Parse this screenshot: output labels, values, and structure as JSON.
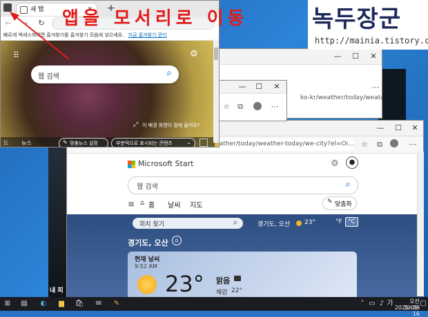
{
  "annotation": "앱을 모서리로 이동",
  "brand": {
    "name": "녹두장군",
    "url": "http://mainia.tistory.com"
  },
  "win_front": {
    "tab_title": "새 탭",
    "new_tab_symbol": "+",
    "favorites_bar_text": "빠르게 액세스하려면 즐겨찾기를 즐겨찾기 모음에 넣으세요.",
    "favorites_link": "지금 즐겨찾기 관리",
    "search_placeholder": "웹 검색",
    "bg_caption": "이 배경 화면이 맘에 들어요?",
    "bottom_left_items": [
      "드",
      "뉴스"
    ],
    "btn_custom_news": "맞춤뉴스 설정",
    "btn_partial": "부분적으로 표시되는 콘텐츠"
  },
  "win_mid": {
    "addr_fragment": "ko-kr/weather/today/weathe"
  },
  "win_back": {
    "addr_fragment": "weather/today/weather-today/we-city?el=Oi...",
    "logo": "Microsoft Start",
    "search_placeholder": "웹 검색",
    "nav": [
      "홈",
      "날씨",
      "지도"
    ],
    "customize_btn": "맞춤화",
    "location_search": "위치 찾기",
    "location_current": "경기도, 오산",
    "temp_small": "23°",
    "unit_f": "°F",
    "unit_c": "°C",
    "location_header": "경기도, 오산",
    "card_title": "현재 날씨",
    "card_time": "9:52 AM",
    "card_temp": "23°",
    "card_condition": "맑음",
    "card_feels": "체감",
    "card_feels_value": "22°"
  },
  "left_strip_text": "내 피",
  "taskbar": {
    "time": "오전 10:38",
    "date": "2021-09-16"
  },
  "colors": {
    "annotation": "#e21a1a",
    "accent": "#0067c0",
    "taskbar": "#1a1c22"
  }
}
